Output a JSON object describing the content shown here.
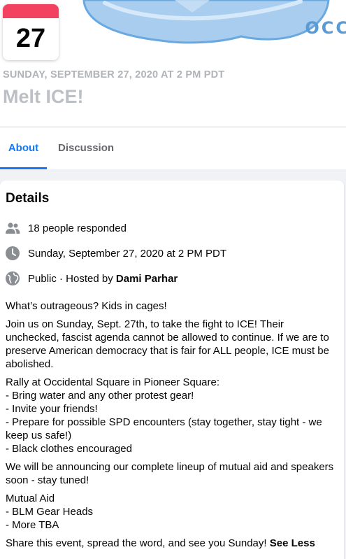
{
  "event": {
    "date_card_day": "27",
    "cover_logo_text": "OCC",
    "datetime_header": "SUNDAY, SEPTEMBER 27, 2020 AT 2 PM PDT",
    "title": "Melt ICE!"
  },
  "tabs": [
    {
      "label": "About",
      "active": true
    },
    {
      "label": "Discussion",
      "active": false
    }
  ],
  "details": {
    "heading": "Details",
    "responded": {
      "icon": "people-icon",
      "text": "18 people responded"
    },
    "when": {
      "icon": "clock-icon",
      "text": "Sunday, September 27, 2020 at 2 PM PDT"
    },
    "privacy": {
      "icon": "globe-icon",
      "prefix": "Public · Hosted by ",
      "host": "Dami Parhar"
    }
  },
  "description": {
    "paragraphs": [
      "What’s outrageous? Kids in cages!",
      "Join us on Sunday, Sept. 27th, to take the fight to ICE! Their unchecked, fascist agenda cannot be allowed to continue. If we are to preserve American democracy that is fair for ALL people, ICE must be abolished.",
      "Rally at Occidental Square in Pioneer Square:\n- Bring water and any other protest gear!\n- Invite your friends!\n- Prepare for possible SPD encounters (stay together, stay tight - we keep us safe!)\n- Black clothes encouraged",
      "We will be announcing our complete lineup of mutual aid and speakers soon - stay tuned!",
      "Mutual Aid\n- BLM Gear Heads\n- More TBA"
    ],
    "closing": "Share this event, spread the word, and see you Sunday! ",
    "see_less": "See Less"
  },
  "colors": {
    "accent": "#1877f2",
    "date_band": "#f3425f",
    "muted_text": "#65676b",
    "icon_gray": "#8a8d91"
  }
}
